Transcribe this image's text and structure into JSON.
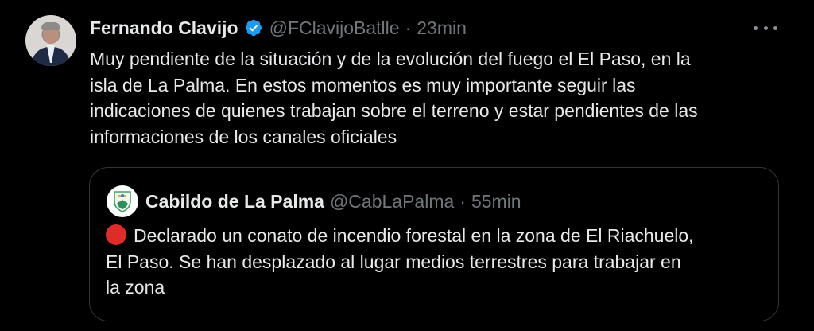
{
  "tweet": {
    "author": {
      "display_name": "Fernando Clavijo",
      "handle": "@FClavijoBatlle",
      "separator": "·",
      "time": "23min",
      "verified": true,
      "verified_badge_color": "#1d9bf0"
    },
    "text_lines": [
      "Muy pendiente de la situación y de la evolución del fuego el El Paso, en la",
      "isla de La Palma. En estos momentos es muy importante seguir las",
      "indicaciones de quienes trabajan sobre el terreno y estar pendientes de las",
      "informaciones de los canales oficiales"
    ],
    "more_icon": "more-horizontal-icon"
  },
  "quoted_tweet": {
    "author": {
      "display_name": "Cabildo de La Palma",
      "handle": "@CabLaPalma",
      "separator": "·",
      "time": "55min"
    },
    "status_icon": "red-circle-emoji",
    "status_color": "#e02b2b",
    "text_lines": [
      "Declarado un conato de incendio forestal en la zona de El Riachuelo,",
      "El Paso. Se han desplazado al lugar medios terrestres para trabajar en",
      "la zona"
    ]
  },
  "colors": {
    "background": "#000000",
    "primary_text": "#e7e9ea",
    "secondary_text": "#71767b",
    "border": "#333639"
  }
}
